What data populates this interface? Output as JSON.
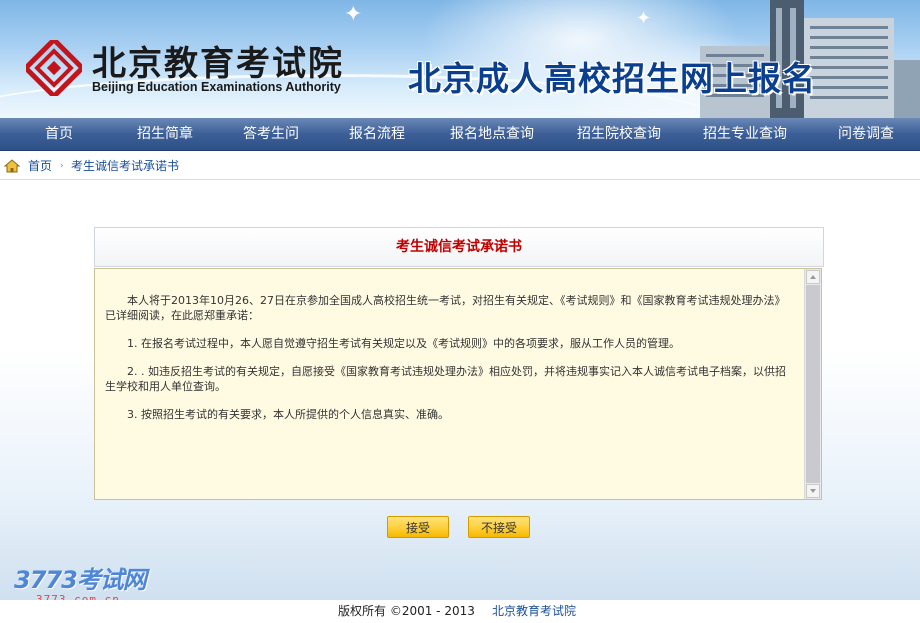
{
  "header": {
    "org_name_cn": "北京教育考试院",
    "org_name_en": "Beijing Education Examinations Authority",
    "site_title": "北京成人高校招生网上报名"
  },
  "nav": {
    "items": [
      "首页",
      "招生简章",
      "答考生问",
      "报名流程",
      "报名地点查询",
      "招生院校查询",
      "招生专业查询",
      "问卷调查"
    ]
  },
  "breadcrumb": {
    "home": "首页",
    "separator": "›",
    "current": "考生诚信考试承诺书"
  },
  "pledge": {
    "title": "考生诚信考试承诺书",
    "intro": "本人将于2013年10月26、27日在京参加全国成人高校招生统一考试，对招生有关规定、《考试规则》和《国家教育考试违规处理办法》已详细阅读，在此愿郑重承诺：",
    "items": [
      "1. 在报名考试过程中，本人愿自觉遵守招生考试有关规定以及《考试规则》中的各项要求，服从工作人员的管理。",
      "2. . 如违反招生考试的有关规定，自愿接受《国家教育考试违规处理办法》相应处罚，并将违规事实记入本人诚信考试电子档案，以供招生学校和用人单位查询。",
      "3. 按照招生考试的有关要求，本人所提供的个人信息真实、准确。"
    ]
  },
  "buttons": {
    "accept": "接受",
    "reject": "不接受"
  },
  "watermark": {
    "brand": "3773考试网",
    "url": "3773.com.cn"
  },
  "footer": {
    "copyright": "版权所有 ©2001 - 2013",
    "org_link": "北京教育考试院"
  },
  "colors": {
    "nav_bg": "#3c5f97",
    "title_red": "#c00000",
    "pledge_bg": "#fffbe3",
    "button_yellow": "#ffcf3a",
    "link_blue": "#1a4f9a"
  }
}
